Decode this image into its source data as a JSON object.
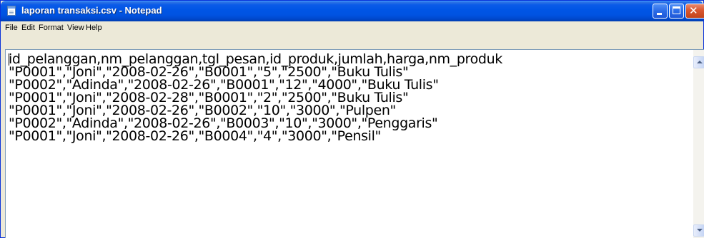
{
  "window": {
    "title": "laporan transaksi.csv - Notepad",
    "title_bar_color": "#0054E3",
    "close_button_color": "#D9572F"
  },
  "title_buttons": {
    "minimize_icon": "minimize-icon",
    "maximize_icon": "maximize-icon",
    "close_icon": "close-icon",
    "close_glyph": "✕"
  },
  "menu": {
    "items": [
      {
        "label": "File"
      },
      {
        "label": "Edit"
      },
      {
        "label": "Format"
      },
      {
        "label": "View"
      },
      {
        "label": "Help"
      }
    ]
  },
  "document": {
    "lines": [
      "id_pelanggan,nm_pelanggan,tgl_pesan,id_produk,jumlah,harga,nm_produk",
      "\"P0001\",\"Joni\",\"2008-02-26\",\"B0001\",\"5\",\"2500\",\"Buku Tulis\"",
      "\"P0002\",\"Adinda\",\"2008-02-26\",\"B0001\",\"12\",\"4000\",\"Buku Tulis\"",
      "\"P0001\",\"Joni\",\"2008-02-28\",\"B0001\",\"2\",\"2500\",\"Buku Tulis\"",
      "\"P0001\",\"Joni\",\"2008-02-26\",\"B0002\",\"10\",\"3000\",\"Pulpen\"",
      "\"P0002\",\"Adinda\",\"2008-02-26\",\"B0003\",\"10\",\"3000\",\"Penggaris\"",
      "\"P0001\",\"Joni\",\"2008-02-26\",\"B0004\",\"4\",\"3000\",\"Pensil\""
    ]
  },
  "scrollbar": {
    "up_icon": "scroll-up-arrow-icon",
    "down_icon": "scroll-down-arrow-icon"
  }
}
